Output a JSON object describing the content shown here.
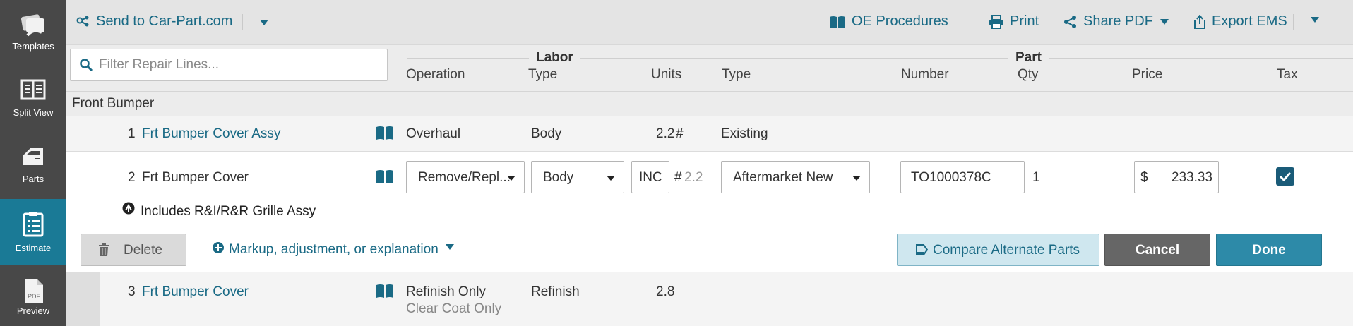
{
  "nav": {
    "items": [
      {
        "label": "Templates",
        "icon": "templates-icon"
      },
      {
        "label": "Split View",
        "icon": "split-view-icon"
      },
      {
        "label": "Parts",
        "icon": "car-door-icon"
      },
      {
        "label": "Estimate",
        "icon": "clipboard-icon"
      },
      {
        "label": "Preview",
        "icon": "pdf-icon",
        "icon_text": "PDF"
      }
    ],
    "active": "Estimate"
  },
  "toolbar": {
    "send_label": "Send to Car-Part.com",
    "oe_label": "OE Procedures",
    "print_label": "Print",
    "share_label": "Share PDF",
    "export_label": "Export EMS"
  },
  "filter": {
    "placeholder": "Filter Repair Lines..."
  },
  "header": {
    "labor_title": "Labor",
    "part_title": "Part",
    "columns": {
      "operation": "Operation",
      "labor_type": "Type",
      "units": "Units",
      "part_type": "Type",
      "number": "Number",
      "qty": "Qty",
      "price": "Price",
      "tax": "Tax"
    }
  },
  "section": {
    "title": "Front Bumper"
  },
  "lines": [
    {
      "num": "1",
      "description": "Frt Bumper Cover Assy",
      "operation": "Overhaul",
      "labor_type": "Body",
      "units": "2.2",
      "units_flag": "#",
      "part_type": "Existing"
    },
    {
      "num": "2",
      "description": "Frt Bumper Cover",
      "operation": "Remove/Repl...",
      "labor_type": "Body",
      "units_value": "INC",
      "units_flag": "#",
      "units_ref": "2.2",
      "part_type": "Aftermarket New",
      "number": "TO1000378C",
      "qty": "1",
      "price_currency": "$",
      "price": "233.33",
      "tax": true,
      "includes_note": "Includes R&I/R&R Grille Assy"
    },
    {
      "num": "3",
      "description": "Frt Bumper Cover",
      "operation": "Refinish Only",
      "operation_sub": "Clear Coat Only",
      "labor_type": "Refinish",
      "units": "2.8"
    }
  ],
  "edit_actions": {
    "delete_label": "Delete",
    "markup_label": "Markup, adjustment, or explanation",
    "compare_label": "Compare Alternate Parts",
    "cancel_label": "Cancel",
    "done_label": "Done"
  },
  "colors": {
    "accent": "#1a6a85",
    "nav_bg": "#484848",
    "nav_active": "#1a7a96",
    "done_bg": "#2d8aa8",
    "cancel_bg": "#666666",
    "compare_bg": "#cfe7ef"
  }
}
